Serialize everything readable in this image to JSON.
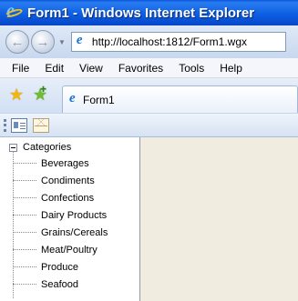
{
  "window": {
    "title": "Form1 - Windows Internet Explorer"
  },
  "address_bar": {
    "url": "http://localhost:1812/Form1.wgx"
  },
  "menu": [
    "File",
    "Edit",
    "View",
    "Favorites",
    "Tools",
    "Help"
  ],
  "tab": {
    "label": "Form1"
  },
  "tree": {
    "root_label": "Categories",
    "items": [
      "Beverages",
      "Condiments",
      "Confections",
      "Dairy Products",
      "Grains/Cereals",
      "Meat/Poultry",
      "Produce",
      "Seafood"
    ]
  },
  "colors": {
    "titlebar": "#0d5fe3",
    "content_background": "#f0ece0"
  }
}
